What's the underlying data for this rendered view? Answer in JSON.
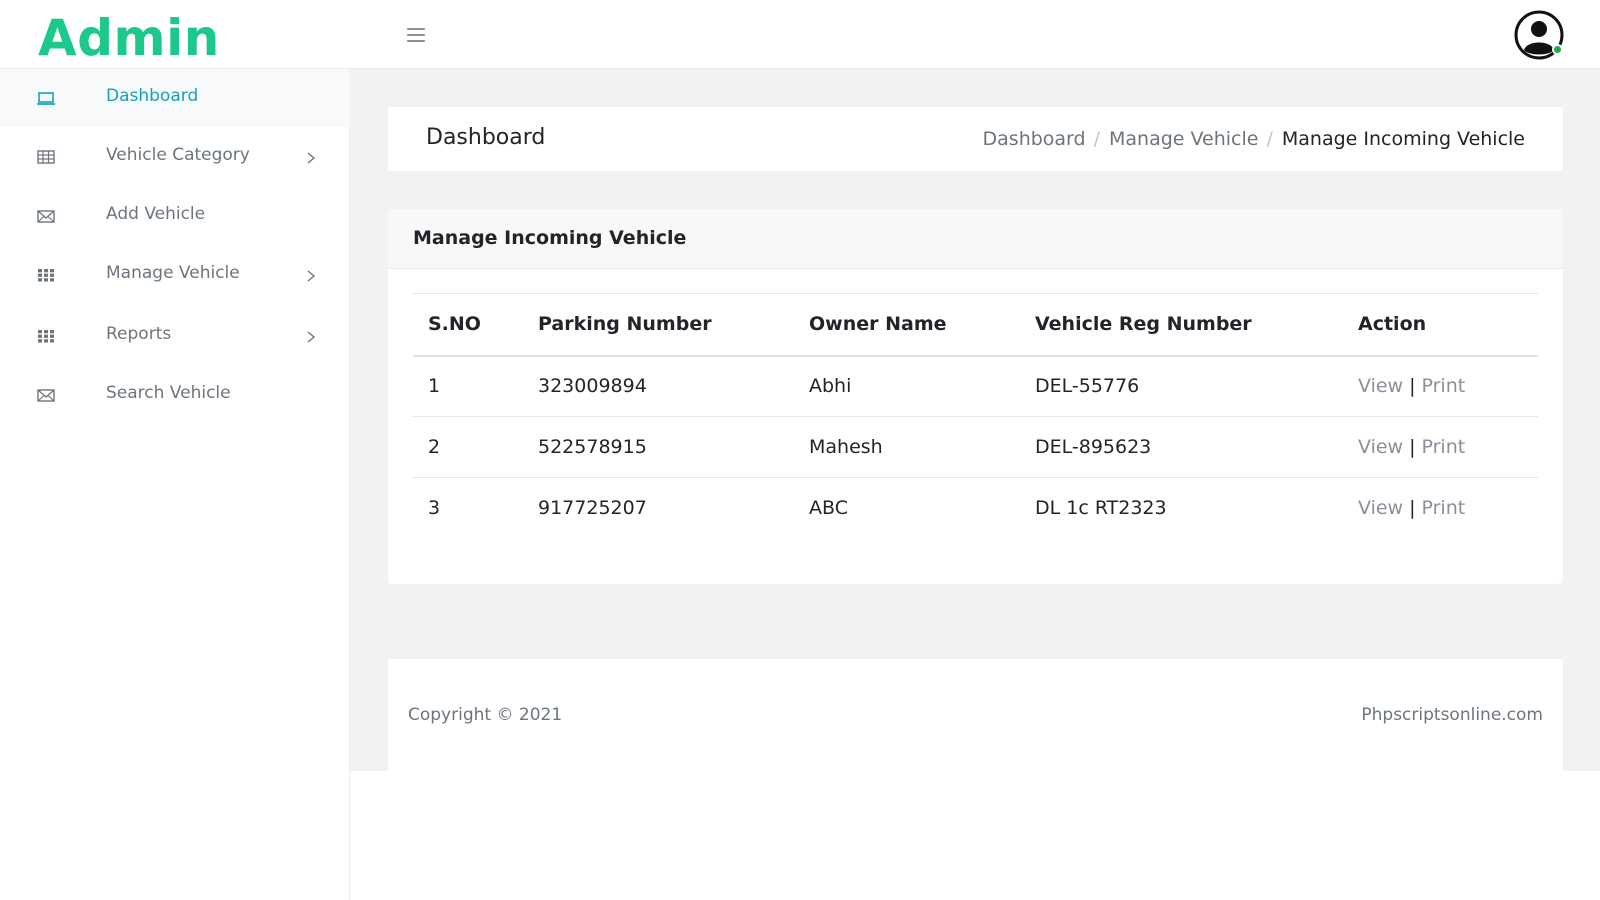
{
  "brand": {
    "title": "Admin",
    "color": "#1cc88a"
  },
  "topbar": {
    "menu_icon": "hamburger-icon",
    "avatar_icon": "user-avatar-icon",
    "status_color": "#28a745"
  },
  "sidebar": {
    "items": [
      {
        "label": "Dashboard",
        "icon": "laptop-icon",
        "active": true,
        "has_submenu": false
      },
      {
        "label": "Vehicle Category",
        "icon": "table-icon",
        "active": false,
        "has_submenu": true
      },
      {
        "label": "Add Vehicle",
        "icon": "envelope-icon",
        "active": false,
        "has_submenu": false
      },
      {
        "label": "Manage Vehicle",
        "icon": "grid-icon",
        "active": false,
        "has_submenu": true
      },
      {
        "label": "Reports",
        "icon": "grid-icon",
        "active": false,
        "has_submenu": true
      },
      {
        "label": "Search Vehicle",
        "icon": "envelope-icon",
        "active": false,
        "has_submenu": false
      }
    ],
    "active_color": "#17a2b8"
  },
  "header": {
    "title": "Dashboard",
    "breadcrumb": [
      "Dashboard",
      "Manage Vehicle",
      "Manage Incoming Vehicle"
    ]
  },
  "card": {
    "title": "Manage Incoming Vehicle",
    "columns": [
      "S.NO",
      "Parking Number",
      "Owner Name",
      "Vehicle Reg Number",
      "Action"
    ],
    "rows": [
      {
        "sno": "1",
        "parking": "323009894",
        "owner": "Abhi",
        "reg": "DEL-55776"
      },
      {
        "sno": "2",
        "parking": "522578915",
        "owner": "Mahesh",
        "reg": "DEL-895623"
      },
      {
        "sno": "3",
        "parking": "917725207",
        "owner": "ABC",
        "reg": "DL 1c RT2323"
      }
    ],
    "actions": {
      "view": "View",
      "separator": "|",
      "print": "Print"
    }
  },
  "footer": {
    "copyright": "Copyright © 2021",
    "site": "Phpscriptsonline.com"
  }
}
